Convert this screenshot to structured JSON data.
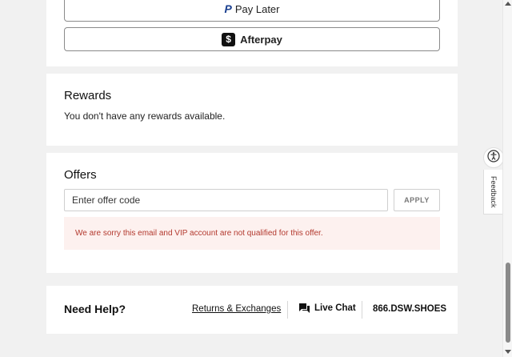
{
  "payment": {
    "paylater_logo": "P",
    "paylater_label": "Pay Later",
    "afterpay_icon": "$",
    "afterpay_label": "Afterpay"
  },
  "rewards": {
    "title": "Rewards",
    "message": "You don't have any rewards available."
  },
  "offers": {
    "title": "Offers",
    "input_placeholder": "Enter offer code",
    "input_value": "",
    "apply_label": "APPLY",
    "error_message": "We are sorry this email and VIP account are not qualified for this offer."
  },
  "help": {
    "title": "Need Help?",
    "returns_label": "Returns & Exchanges",
    "live_chat_label": "Live Chat",
    "phone": "866.DSW.SHOES"
  },
  "side": {
    "feedback_label": "Feedback"
  },
  "icons": {
    "paylater": "paypal-icon",
    "afterpay": "afterpay-icon",
    "chat": "chat-bubble-icon",
    "accessibility": "accessibility-icon"
  },
  "colors": {
    "error_text": "#b3392e",
    "error_bg": "#fdf1ef",
    "paypal_blue": "#1a3f8f"
  }
}
